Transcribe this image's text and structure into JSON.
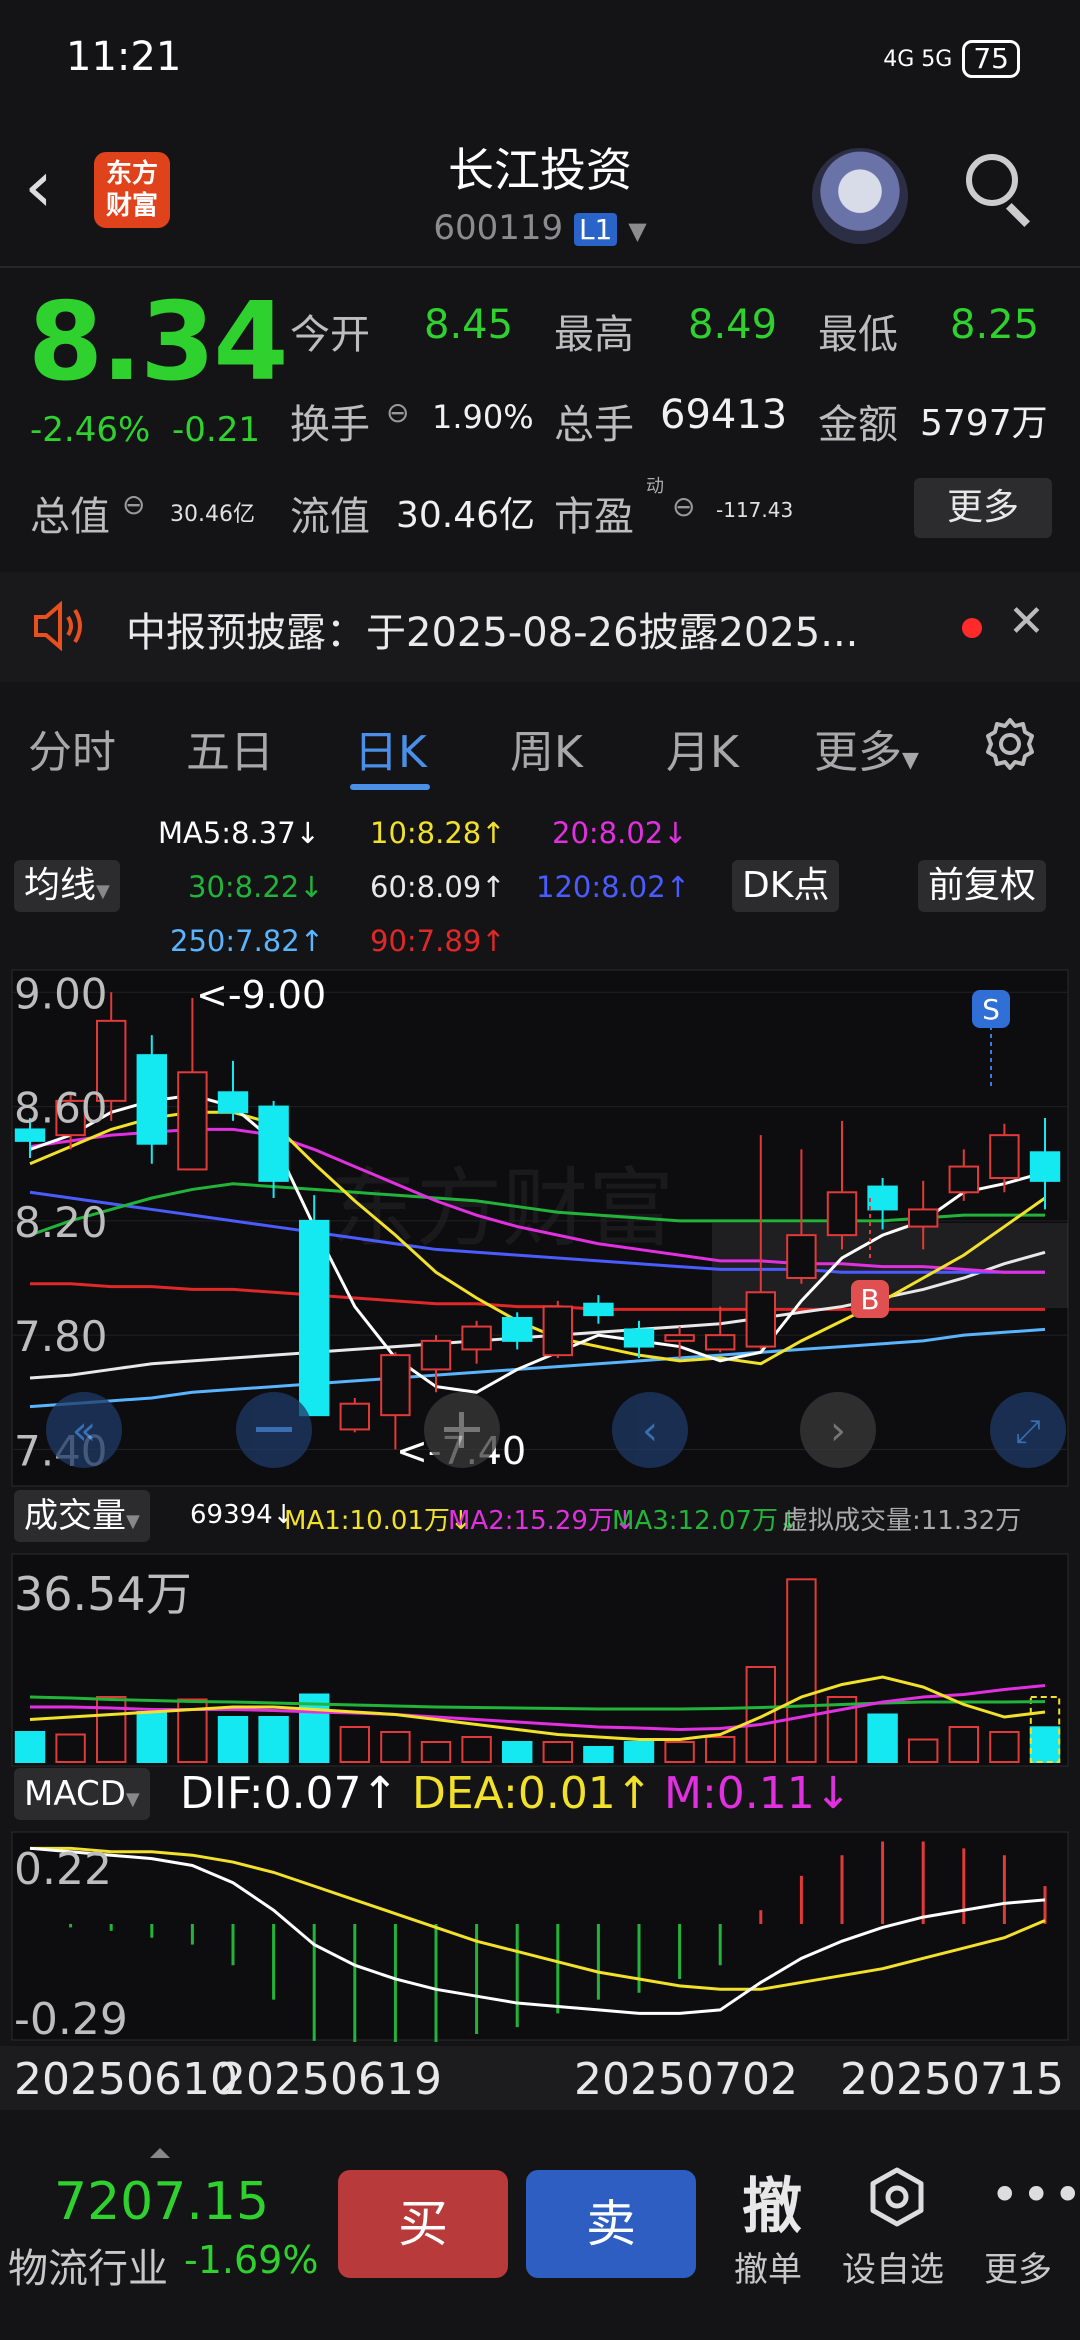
{
  "status_bar": {
    "time": "11:21",
    "signal": "4G 5G",
    "battery": "75"
  },
  "header": {
    "title": "长江投资",
    "code": "600119",
    "badge": "L1",
    "logo_text": "东方财富"
  },
  "quote": {
    "price": "8.34",
    "change_pct": "-2.46%",
    "change": "-0.21",
    "open_label": "今开",
    "open": "8.45",
    "high_label": "最高",
    "high": "8.49",
    "low_label": "最低",
    "low": "8.25",
    "turnover_label": "换手",
    "turnover": "1.90%",
    "volume_label": "总手",
    "volume": "69413",
    "amount_label": "金额",
    "amount": "5797万",
    "mktcap_label": "总值",
    "mktcap": "30.46亿",
    "float_label": "流值",
    "float_cap": "30.46亿",
    "pe_label": "市盈",
    "pe_sup": "动",
    "pe": "-117.43",
    "more": "更多"
  },
  "notice": {
    "text": "中报预披露：于2025-08-26披露2025..."
  },
  "tabs": [
    {
      "label": "分时"
    },
    {
      "label": "五日"
    },
    {
      "label": "日K"
    },
    {
      "label": "周K"
    },
    {
      "label": "月K"
    },
    {
      "label": "更多"
    }
  ],
  "indicators": {
    "ma_button": "均线",
    "ma5": "MA5:8.37↓",
    "ma10": "10:8.28↑",
    "ma20": "20:8.02↓",
    "ma30": "30:8.22↓",
    "ma60": "60:8.09↑",
    "ma120": "120:8.02↑",
    "ma250": "250:7.82↑",
    "ma90": "90:7.89↑",
    "dk_button": "DK点",
    "fq_button": "前复权"
  },
  "kline": {
    "y_labels": [
      "9.00",
      "8.60",
      "8.20",
      "7.80",
      "7.40"
    ],
    "high_marker": "<-9.00",
    "low_marker": "<-7.40",
    "sell_marker": "S",
    "buy_marker": "B",
    "watermark": "东方财富"
  },
  "volume": {
    "button": "成交量",
    "current": "69394↓",
    "ma1": "MA1:10.01万↓",
    "ma2": "MA2:15.29万↓",
    "ma3": "MA3:12.07万↓",
    "virtual": "虚拟成交量:11.32万",
    "max_label": "36.54万"
  },
  "macd": {
    "button": "MACD",
    "dif": "DIF:0.07↑",
    "dea": "DEA:0.01↑",
    "m": "M:0.11↓",
    "top_label": "0.22",
    "bottom_label": "-0.29"
  },
  "dates": [
    "20250610",
    "20250619",
    "20250702",
    "20250715"
  ],
  "bottom": {
    "index_value": "7207.15",
    "index_name": "物流行业",
    "index_change": "-1.69%",
    "buy": "买",
    "sell": "卖",
    "cancel_icon": "撤",
    "cancel": "撤单",
    "watch": "设自选",
    "more": "更多"
  },
  "colors": {
    "up": "#e03a3a",
    "down": "#14e8f0",
    "green": "#2fd12f"
  },
  "chart_data": {
    "type": "candlestick",
    "dates": [
      "20250610",
      "20250619",
      "20250702",
      "20250715"
    ],
    "candles": [
      {
        "o": 8.52,
        "h": 8.56,
        "l": 8.42,
        "c": 8.48
      },
      {
        "o": 8.5,
        "h": 8.65,
        "l": 8.45,
        "c": 8.62
      },
      {
        "o": 8.62,
        "h": 9.0,
        "l": 8.55,
        "c": 8.9
      },
      {
        "o": 8.78,
        "h": 8.85,
        "l": 8.4,
        "c": 8.47
      },
      {
        "o": 8.38,
        "h": 8.98,
        "l": 8.38,
        "c": 8.72
      },
      {
        "o": 8.65,
        "h": 8.76,
        "l": 8.55,
        "c": 8.58
      },
      {
        "o": 8.6,
        "h": 8.62,
        "l": 8.28,
        "c": 8.34
      },
      {
        "o": 8.2,
        "h": 8.29,
        "l": 7.52,
        "c": 7.52
      },
      {
        "o": 7.47,
        "h": 7.58,
        "l": 7.46,
        "c": 7.56
      },
      {
        "o": 7.52,
        "h": 7.74,
        "l": 7.4,
        "c": 7.73
      },
      {
        "o": 7.68,
        "h": 7.8,
        "l": 7.6,
        "c": 7.78
      },
      {
        "o": 7.75,
        "h": 7.85,
        "l": 7.7,
        "c": 7.83
      },
      {
        "o": 7.86,
        "h": 7.88,
        "l": 7.75,
        "c": 7.78
      },
      {
        "o": 7.73,
        "h": 7.92,
        "l": 7.72,
        "c": 7.9
      },
      {
        "o": 7.91,
        "h": 7.94,
        "l": 7.84,
        "c": 7.87
      },
      {
        "o": 7.82,
        "h": 7.85,
        "l": 7.72,
        "c": 7.76
      },
      {
        "o": 7.78,
        "h": 7.83,
        "l": 7.72,
        "c": 7.8
      },
      {
        "o": 7.75,
        "h": 7.9,
        "l": 7.74,
        "c": 7.8
      },
      {
        "o": 7.76,
        "h": 8.5,
        "l": 7.75,
        "c": 7.95
      },
      {
        "o": 8.0,
        "h": 8.45,
        "l": 7.98,
        "c": 8.15
      },
      {
        "o": 8.15,
        "h": 8.55,
        "l": 8.1,
        "c": 8.3
      },
      {
        "o": 8.32,
        "h": 8.35,
        "l": 8.17,
        "c": 8.24
      },
      {
        "o": 8.18,
        "h": 8.34,
        "l": 8.1,
        "c": 8.24
      },
      {
        "o": 8.3,
        "h": 8.45,
        "l": 8.27,
        "c": 8.39
      },
      {
        "o": 8.35,
        "h": 8.54,
        "l": 8.3,
        "c": 8.5
      },
      {
        "o": 8.44,
        "h": 8.56,
        "l": 8.24,
        "c": 8.34
      }
    ],
    "y_range": [
      7.3,
      9.05
    ],
    "ma5": [
      8.45,
      8.5,
      8.58,
      8.62,
      8.64,
      8.6,
      8.48,
      8.18,
      7.9,
      7.72,
      7.62,
      7.6,
      7.68,
      7.74,
      7.8,
      7.78,
      7.76,
      7.71,
      7.74,
      7.92,
      8.07,
      8.15,
      8.2,
      8.3,
      8.33,
      8.37
    ],
    "ma10": [
      8.4,
      8.46,
      8.52,
      8.56,
      8.58,
      8.58,
      8.54,
      8.4,
      8.27,
      8.15,
      8.02,
      7.93,
      7.85,
      7.79,
      7.76,
      7.73,
      7.71,
      7.72,
      7.7,
      7.78,
      7.85,
      7.92,
      8.0,
      8.08,
      8.18,
      8.28
    ],
    "ma20": [
      8.46,
      8.48,
      8.5,
      8.51,
      8.52,
      8.52,
      8.5,
      8.45,
      8.39,
      8.33,
      8.27,
      8.22,
      8.18,
      8.15,
      8.12,
      8.1,
      8.08,
      8.06,
      8.06,
      8.05,
      8.05,
      8.04,
      8.04,
      8.03,
      8.02,
      8.02
    ],
    "ma30": [
      8.15,
      8.2,
      8.24,
      8.28,
      8.31,
      8.33,
      8.32,
      8.31,
      8.3,
      8.29,
      8.28,
      8.27,
      8.25,
      8.23,
      8.22,
      8.21,
      8.2,
      8.2,
      8.2,
      8.2,
      8.2,
      8.2,
      8.21,
      8.22,
      8.22,
      8.22
    ],
    "ma60": [
      7.65,
      7.66,
      7.68,
      7.7,
      7.71,
      7.72,
      7.73,
      7.74,
      7.75,
      7.76,
      7.77,
      7.78,
      7.79,
      7.8,
      7.81,
      7.82,
      7.83,
      7.84,
      7.86,
      7.88,
      7.9,
      7.93,
      7.96,
      8.0,
      8.05,
      8.09
    ],
    "ma90": [
      7.98,
      7.98,
      7.97,
      7.97,
      7.96,
      7.96,
      7.95,
      7.94,
      7.93,
      7.92,
      7.91,
      7.91,
      7.9,
      7.9,
      7.89,
      7.89,
      7.89,
      7.89,
      7.89,
      7.89,
      7.89,
      7.89,
      7.89,
      7.89,
      7.89,
      7.89
    ],
    "ma120": [
      8.3,
      8.28,
      8.26,
      8.24,
      8.22,
      8.2,
      8.18,
      8.16,
      8.14,
      8.12,
      8.1,
      8.09,
      8.08,
      8.07,
      8.06,
      8.05,
      8.04,
      8.03,
      8.03,
      8.03,
      8.02,
      8.02,
      8.02,
      8.02,
      8.02,
      8.02
    ],
    "ma250": [
      7.55,
      7.56,
      7.57,
      7.58,
      7.6,
      7.61,
      7.62,
      7.63,
      7.64,
      7.65,
      7.66,
      7.67,
      7.68,
      7.69,
      7.7,
      7.71,
      7.72,
      7.73,
      7.74,
      7.75,
      7.76,
      7.77,
      7.78,
      7.8,
      7.81,
      7.82
    ],
    "volume": [
      6.0,
      5.5,
      13.0,
      10.0,
      12.5,
      9.0,
      9.0,
      13.5,
      7.0,
      6.0,
      4.0,
      5.0,
      4.0,
      4.0,
      3.0,
      4.0,
      4.0,
      5.0,
      19.0,
      36.54,
      13.0,
      9.5,
      4.5,
      7.0,
      6.0,
      6.94
    ],
    "vol_max": 40,
    "vol_ma1": [
      8.5,
      9.0,
      9.5,
      10.0,
      10.5,
      11.0,
      11.0,
      10.5,
      10.0,
      9.5,
      8.5,
      7.5,
      6.5,
      5.5,
      5.0,
      4.5,
      4.5,
      5.5,
      9.0,
      13.0,
      15.5,
      17.0,
      15.0,
      11.5,
      9.0,
      10.01
    ],
    "vol_ma2": [
      11.0,
      11.0,
      10.8,
      10.5,
      10.5,
      10.5,
      10.3,
      10.0,
      9.8,
      9.5,
      9.0,
      8.5,
      8.0,
      7.5,
      7.0,
      6.8,
      6.5,
      6.7,
      7.5,
      9.0,
      10.5,
      12.0,
      13.0,
      13.5,
      14.5,
      15.29
    ],
    "vol_ma3": [
      13.0,
      12.8,
      12.5,
      12.3,
      12.1,
      12.0,
      11.8,
      11.6,
      11.4,
      11.2,
      11.0,
      10.9,
      10.8,
      10.7,
      10.6,
      10.6,
      10.6,
      10.7,
      10.9,
      11.2,
      11.5,
      11.8,
      12.0,
      12.0,
      12.0,
      12.07
    ],
    "macd_dif": [
      0.22,
      0.21,
      0.2,
      0.19,
      0.17,
      0.12,
      0.04,
      -0.06,
      -0.12,
      -0.16,
      -0.19,
      -0.21,
      -0.23,
      -0.24,
      -0.25,
      -0.26,
      -0.26,
      -0.25,
      -0.17,
      -0.1,
      -0.05,
      -0.01,
      0.02,
      0.04,
      0.06,
      0.07
    ],
    "macd_dea": [
      0.22,
      0.22,
      0.21,
      0.21,
      0.2,
      0.18,
      0.15,
      0.11,
      0.07,
      0.03,
      -0.01,
      -0.05,
      -0.08,
      -0.11,
      -0.14,
      -0.16,
      -0.18,
      -0.19,
      -0.19,
      -0.17,
      -0.15,
      -0.13,
      -0.1,
      -0.07,
      -0.04,
      0.01
    ],
    "macd_m": [
      0.0,
      -0.01,
      -0.02,
      -0.04,
      -0.06,
      -0.12,
      -0.22,
      -0.34,
      -0.38,
      -0.38,
      -0.36,
      -0.32,
      -0.3,
      -0.26,
      -0.22,
      -0.2,
      -0.16,
      -0.12,
      0.04,
      0.14,
      0.2,
      0.24,
      0.24,
      0.22,
      0.2,
      0.11
    ],
    "macd_range": [
      -0.32,
      0.25
    ]
  }
}
